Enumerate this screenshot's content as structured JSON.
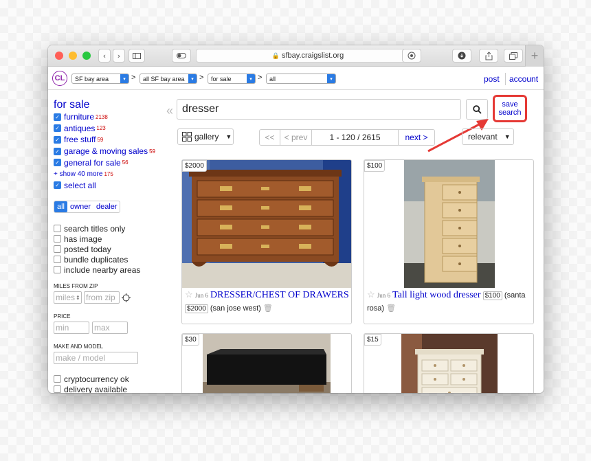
{
  "browser": {
    "url": "sfbay.craigslist.org",
    "lock_icon": "lock-icon",
    "reload_icon": "reload-icon",
    "new_tab": "+"
  },
  "header": {
    "logo": "CL",
    "breadcrumb": [
      {
        "label": "SF bay area"
      },
      {
        "label": "all SF bay area"
      },
      {
        "label": "for sale"
      },
      {
        "label": "all"
      }
    ],
    "separator": ">",
    "post": "post",
    "account": "account"
  },
  "sidebar": {
    "title": "for sale",
    "categories": [
      {
        "label": "furniture",
        "count": "2138"
      },
      {
        "label": "antiques",
        "count": "123"
      },
      {
        "label": "free stuff",
        "count": "59"
      },
      {
        "label": "garage & moving sales",
        "count": "59"
      },
      {
        "label": "general for sale",
        "count": "56"
      }
    ],
    "show_more": "+ show 40 more",
    "show_more_count": "175",
    "select_all": "select all",
    "seller_filter": [
      "all",
      "owner",
      "dealer"
    ],
    "options": [
      "search titles only",
      "has image",
      "posted today",
      "bundle duplicates",
      "include nearby areas"
    ],
    "miles_label": "MILES FROM ZIP",
    "miles_placeholder": "miles",
    "zip_placeholder": "from zip",
    "price_label": "PRICE",
    "min_placeholder": "min",
    "max_placeholder": "max",
    "make_label": "MAKE AND MODEL",
    "make_placeholder": "make / model",
    "options2": [
      "cryptocurrency ok",
      "delivery available"
    ]
  },
  "search": {
    "query": "dresser",
    "save_line1": "save",
    "save_line2": "search"
  },
  "toolbar": {
    "view": "gallery",
    "first": "<<",
    "prev": "< prev",
    "range": "1 - 120 / 2615",
    "next": "next >",
    "sort": "relevant"
  },
  "listings": [
    {
      "price": "$2000",
      "date": "Jun 6",
      "title": "DRESSER/CHEST OF DRAWERS",
      "price_box": "$2000",
      "location": "(san jose west)"
    },
    {
      "price": "$100",
      "date": "Jun 6",
      "title": "Tall light wood dresser",
      "price_box": "$100",
      "location": "(santa rosa)"
    },
    {
      "price": "$30"
    },
    {
      "price": "$15"
    }
  ],
  "colors": {
    "link": "#0000cc",
    "accent_blue": "#2a7be4",
    "highlight_red": "#e53935",
    "count_red": "#cc0000"
  }
}
